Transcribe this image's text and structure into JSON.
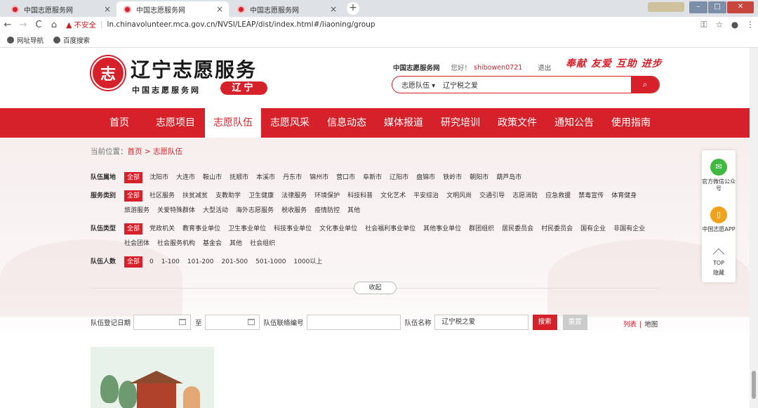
{
  "browser": {
    "tabs": [
      {
        "title": "中国志愿服务网",
        "active": false
      },
      {
        "title": "中国志愿服务网",
        "active": true
      },
      {
        "title": "中国志愿服务网",
        "active": false
      }
    ],
    "tab_close": "×",
    "new_tab": "+",
    "window_buttons": {
      "minimize": "–",
      "maximize": "□",
      "close": "✕"
    },
    "nav": {
      "back": "←",
      "forward": "→",
      "reload": "C",
      "home": "⌂"
    },
    "security_label": "不安全",
    "url": "ln.chinavolunteer.mca.gov.cn/NVSI/LEAP/dist/index.html#/liaoning/group",
    "toolbar_icons": {
      "key": "⚿",
      "star": "☆",
      "account": "●",
      "menu": "⋮"
    },
    "bookmarks": [
      "网址导航",
      "百度搜索"
    ]
  },
  "header": {
    "logo_glyph": "志",
    "logo_title": "辽宁志愿服务",
    "logo_subtitle": "中国志愿服务网",
    "province_badge": "辽宁",
    "site_name": "中国志愿服务网",
    "greeting": "您好！",
    "username": "shibowen0721",
    "logout": "退出",
    "slogan": "奉献 友爱 互助 进步",
    "search": {
      "category": "志愿队伍 ▾",
      "value": "辽宁税之爱",
      "button_icon": "⌕"
    }
  },
  "nav_items": [
    "首页",
    "志愿项目",
    "志愿队伍",
    "志愿风采",
    "信息动态",
    "媒体报道",
    "研究培训",
    "政策文件",
    "通知公告",
    "使用指南"
  ],
  "breadcrumb": {
    "prefix": "当前位置：",
    "home": "首页",
    "sep": " > ",
    "current": "志愿队伍"
  },
  "filters": {
    "region": {
      "label": "队伍属地",
      "values": [
        "全部",
        "沈阳市",
        "大连市",
        "鞍山市",
        "抚顺市",
        "本溪市",
        "丹东市",
        "锦州市",
        "营口市",
        "阜新市",
        "辽阳市",
        "盘锦市",
        "铁岭市",
        "朝阳市",
        "葫芦岛市"
      ]
    },
    "service": {
      "label": "服务类别",
      "values": [
        "全部",
        "社区服务",
        "扶贫减贫",
        "支教助学",
        "卫生健康",
        "法律服务",
        "环境保护",
        "科技科普",
        "文化艺术",
        "平安综治",
        "文明风尚",
        "交通引导",
        "志愿消防",
        "应急救援",
        "禁毒宣传",
        "体育健身",
        "旅游服务",
        "关爱特殊群体",
        "大型活动",
        "海外志愿服务",
        "税收服务",
        "疫情防控",
        "其他"
      ]
    },
    "team_type": {
      "label": "队伍类型",
      "values": [
        "全部",
        "党政机关",
        "教育事业单位",
        "卫生事业单位",
        "科技事业单位",
        "文化事业单位",
        "社会福利事业单位",
        "其他事业单位",
        "群团组织",
        "居民委员会",
        "村民委员会",
        "国有企业",
        "非国有企业",
        "社会团体",
        "社会服务机构",
        "基金会",
        "其他",
        "社会组织"
      ]
    },
    "team_size": {
      "label": "队伍人数",
      "values": [
        "全部",
        "0",
        "1-100",
        "101-200",
        "201-500",
        "501-1000",
        "1000以上"
      ]
    }
  },
  "collapse_label": "收起",
  "query": {
    "date_label": "队伍登记日期",
    "to_label": "至",
    "contact_label": "队伍联络编号",
    "name_label": "队伍名称",
    "name_value": "辽宁税之爱",
    "search_btn": "搜索",
    "reset_btn": "重置"
  },
  "view_switch": {
    "list": "列表",
    "divider": "|",
    "map": "地图"
  },
  "float_panel": {
    "wechat": "官方微信公众号",
    "wechat_icon": "wechat-icon",
    "app": "中国志愿APP",
    "app_icon": "phone-icon",
    "top": "TOP",
    "hide": "隐藏"
  },
  "colors": {
    "brand": "#d6202a",
    "wechat": "#3fb93f",
    "app": "#f0a21b"
  }
}
